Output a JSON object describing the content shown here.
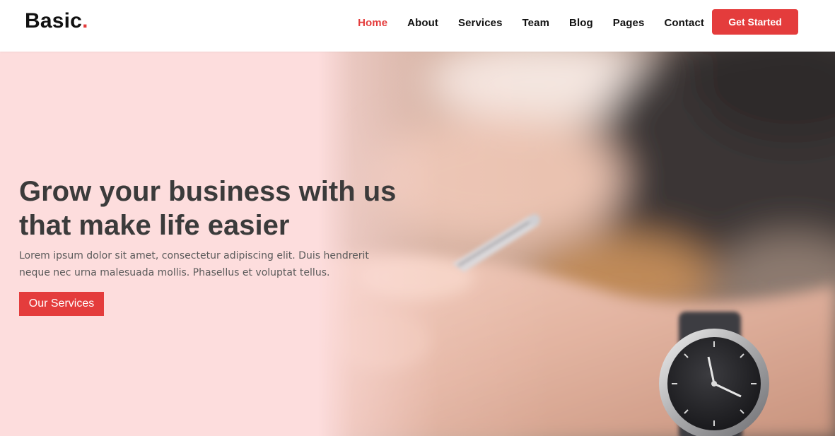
{
  "brand": {
    "name": "Basic",
    "dot": "."
  },
  "nav": {
    "items": [
      {
        "label": "Home",
        "active": true
      },
      {
        "label": "About"
      },
      {
        "label": "Services"
      },
      {
        "label": "Team"
      },
      {
        "label": "Blog"
      },
      {
        "label": "Pages"
      },
      {
        "label": "Contact"
      }
    ],
    "cta_label": "Get Started"
  },
  "hero": {
    "title_line1": "Grow your business with us",
    "title_line2": "that make life easier",
    "text_line1": "Lorem ipsum dolor sit amet, consectetur adipiscing elit. Duis hendrerit",
    "text_line2": "neque nec urna malesuada mollis. Phasellus et voluptat tellus.",
    "button_label": "Our Services"
  },
  "colors": {
    "accent": "#e43c3c",
    "hero_tint": "#fddddd",
    "heading": "#3b3b3b",
    "nav_text": "#111111"
  },
  "icons": {
    "hero_background": "hand-with-pen-and-wristwatch-photo"
  }
}
